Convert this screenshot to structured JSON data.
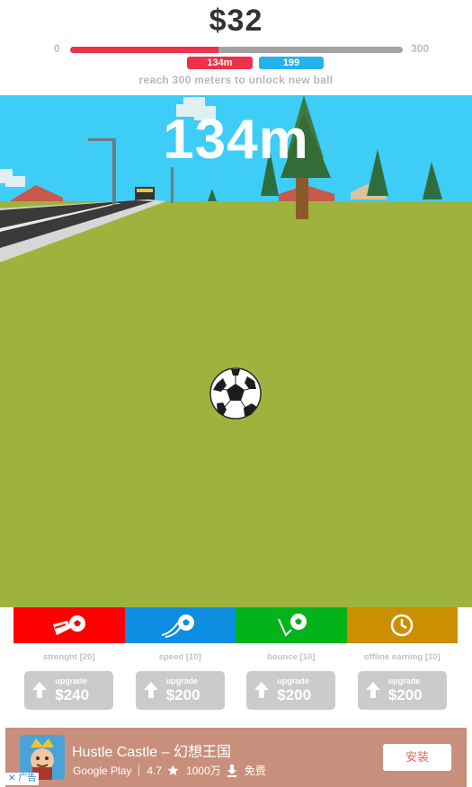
{
  "header": {
    "money": "$32",
    "progress_min": "0",
    "progress_max": "300",
    "progress_fraction": 0.447,
    "current_distance_badge": "134m",
    "best_distance_badge": "199",
    "unlock_hint": "reach 300 meters to unlock new ball"
  },
  "game": {
    "distance": "134m",
    "ball_icon": "soccer-ball-icon"
  },
  "upgrades": [
    {
      "name": "strength",
      "label": "strenght [20]",
      "button_top": "upgrade",
      "button_price": "$240",
      "color": "#fe0000",
      "icon": "kick-ball-icon"
    },
    {
      "name": "speed",
      "label": "speed [10]",
      "button_top": "upgrade",
      "button_price": "$200",
      "color": "#0d8ee0",
      "icon": "speed-ball-icon"
    },
    {
      "name": "bounce",
      "label": "bounce [10]",
      "button_top": "upgrade",
      "button_price": "$200",
      "color": "#03b31c",
      "icon": "bounce-ball-icon"
    },
    {
      "name": "offline-earning",
      "label": "offline earning [10]",
      "button_top": "upgrade",
      "button_price": "$200",
      "color": "#cc8f00",
      "icon": "clock-icon"
    }
  ],
  "ad": {
    "title": "Hustle Castle – 幻想王国",
    "store": "Google Play",
    "rating": "4.7",
    "downloads": "1000万",
    "price": "免费",
    "install_label": "安装",
    "ad_label": "广告",
    "icons": [
      "star-icon",
      "download-icon",
      "close-icon",
      "app-icon"
    ]
  },
  "colors": {
    "progress_fill": "#ee3049",
    "best_badge": "#23b2ec",
    "grass": "#9eb33d",
    "sky": "#3ecdf6",
    "ad_bg": "#c8907c"
  }
}
